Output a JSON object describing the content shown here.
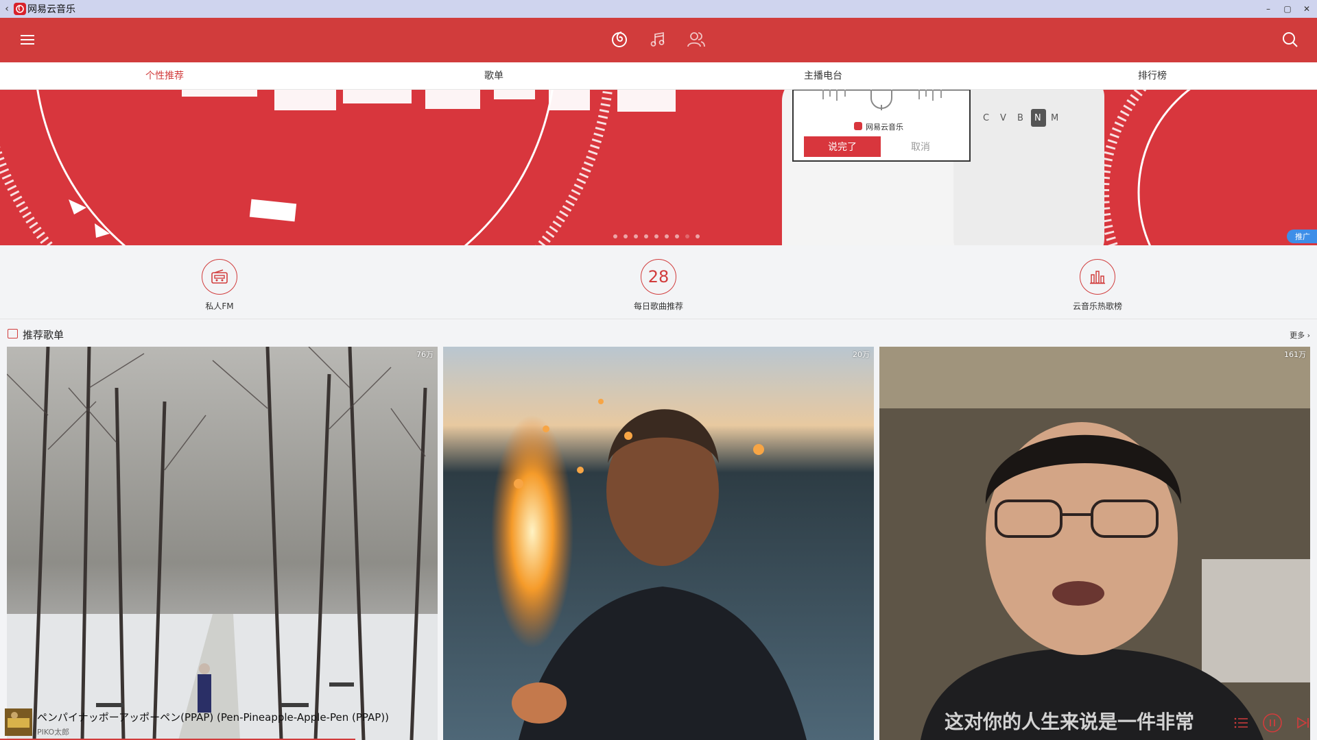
{
  "window": {
    "title": "网易云音乐",
    "back_icon": "chevron-left-icon",
    "controls": [
      "minimize-icon",
      "maximize-icon",
      "close-icon"
    ]
  },
  "appbar": {
    "menu_icon": "hamburger-menu-icon",
    "center_icons": [
      "netease-music-icon",
      "music-note-icon",
      "friends-icon"
    ],
    "search_icon": "search-icon",
    "color": "#d13c3c"
  },
  "tabs": [
    {
      "label": "个性推荐",
      "active": true
    },
    {
      "label": "歌单",
      "active": false
    },
    {
      "label": "主播电台",
      "active": false
    },
    {
      "label": "排行榜",
      "active": false
    }
  ],
  "banner": {
    "promo_label": "推广",
    "phone_app_label": "网易云音乐",
    "btn_done": "说完了",
    "btn_cancel": "取消",
    "dot_count": 9,
    "active_dot": 7
  },
  "shortcuts": [
    {
      "label": "私人FM",
      "icon": "radio-icon"
    },
    {
      "label": "每日歌曲推荐",
      "icon_text": "28"
    },
    {
      "label": "云音乐热歌榜",
      "icon": "bar-chart-icon"
    }
  ],
  "section": {
    "title": "推荐歌单",
    "more": "更多"
  },
  "playlists": [
    {
      "play_count": "76万",
      "scene": "snowy park"
    },
    {
      "play_count": "20万",
      "scene": "woman with sparkler"
    },
    {
      "play_count": "161万",
      "scene": "man speaking"
    }
  ],
  "subtitle": "这对你的人生来说是一件非常",
  "player": {
    "song": "ペンパイナッポーアッポーペン(PPAP) (Pen-Pineapple-Apple-Pen (PPAP))",
    "artist": "PIKO太郎",
    "progress": 0.27,
    "icons": [
      "playlist-icon",
      "pause-icon",
      "next-icon"
    ]
  }
}
